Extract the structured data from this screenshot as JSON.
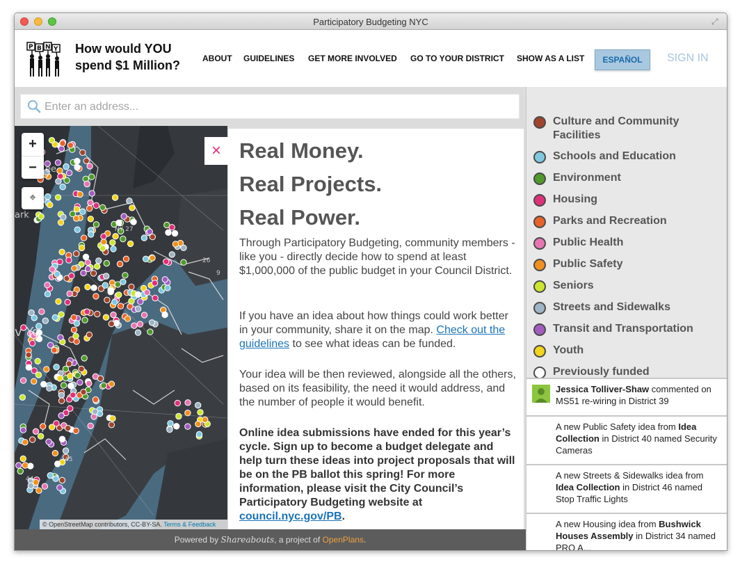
{
  "window": {
    "title": "Participatory Budgeting NYC"
  },
  "header": {
    "logo_text": "PBNYC",
    "tagline_line1": "How would YOU",
    "tagline_line2": "spend $1 Million?",
    "nav": [
      "ABOUT",
      "GUIDELINES",
      "GET MORE INVOLVED",
      "GO TO YOUR DISTRICT",
      "SHOW AS A LIST"
    ],
    "espanol": "ESPAÑOL",
    "signin": "SIGN IN"
  },
  "search": {
    "placeholder": "Enter an address..."
  },
  "map": {
    "zoom_in": "+",
    "zoom_out": "−",
    "attribution_text": "© OpenStreetMap contributors, CC-BY-SA.",
    "attribution_link": "Terms & Feedback",
    "labels": [
      "ee",
      "ark",
      "v Yo",
      "NY 27",
      "45",
      "44",
      "9",
      "26"
    ]
  },
  "info": {
    "close": "×",
    "headlines": [
      "Real Money.",
      "Real Projects.",
      "Real Power."
    ],
    "para1": "Through Participatory Budgeting, community members - like you - directly decide how to spend at least $1,000,000 of the public budget in your Council District.",
    "para2_a": "If you have an idea about how things could work better in your community, share it on the map.",
    "para2_link": "Check out the guidelines",
    "para2_b": "to see what ideas can be funded.",
    "para3": "Your idea will be then reviewed, alongside all the others, based on its feasibility, the need it would address, and the number of people it would benefit.",
    "para4": "Online idea submissions have ended for this year’s cycle. Sign up to become a budget delegate and help turn these ideas into project proposals that will be on the PB ballot this spring! For more information, please visit the City Council’s Participatory Budgeting website at",
    "para4_link": "council.nyc.gov/PB",
    "para4_end": "."
  },
  "footer": {
    "powered": "Powered by",
    "brand": "Shareabouts",
    "mid": ", a project of",
    "org": "OpenPlans",
    "end": "."
  },
  "legend": [
    {
      "label": "Culture and Community Facilities",
      "color": "#a0452c"
    },
    {
      "label": "Schools and Education",
      "color": "#7fc8e0"
    },
    {
      "label": "Environment",
      "color": "#4f9a2a"
    },
    {
      "label": "Housing",
      "color": "#e0307a"
    },
    {
      "label": "Parks and Recreation",
      "color": "#e8622a"
    },
    {
      "label": "Public Health",
      "color": "#e874b0"
    },
    {
      "label": "Public Safety",
      "color": "#f0901e"
    },
    {
      "label": "Seniors",
      "color": "#cce62e"
    },
    {
      "label": "Streets and Sidewalks",
      "color": "#9fb4c4"
    },
    {
      "label": "Transit and Transportation",
      "color": "#a45cc0"
    },
    {
      "label": "Youth",
      "color": "#f2d41a"
    },
    {
      "label": "Previously funded",
      "color": "#ffffff"
    }
  ],
  "activity": [
    {
      "name": "Jessica Tolliver-Shaw",
      "text": "commented on MS51 re-wiring in District 39"
    },
    {
      "pre": "A new Public Safety idea from",
      "who": "Idea Collection",
      "post": "in District 40 named Security Cameras"
    },
    {
      "pre": "A new Streets & Sidewalks idea from",
      "who": "Idea Collection",
      "post": "in District 46 named Stop Traffic Lights"
    },
    {
      "pre": "A new Housing idea from",
      "who": "Bushwick Houses Assembly",
      "post": "in District 34 named PRO A..."
    }
  ]
}
